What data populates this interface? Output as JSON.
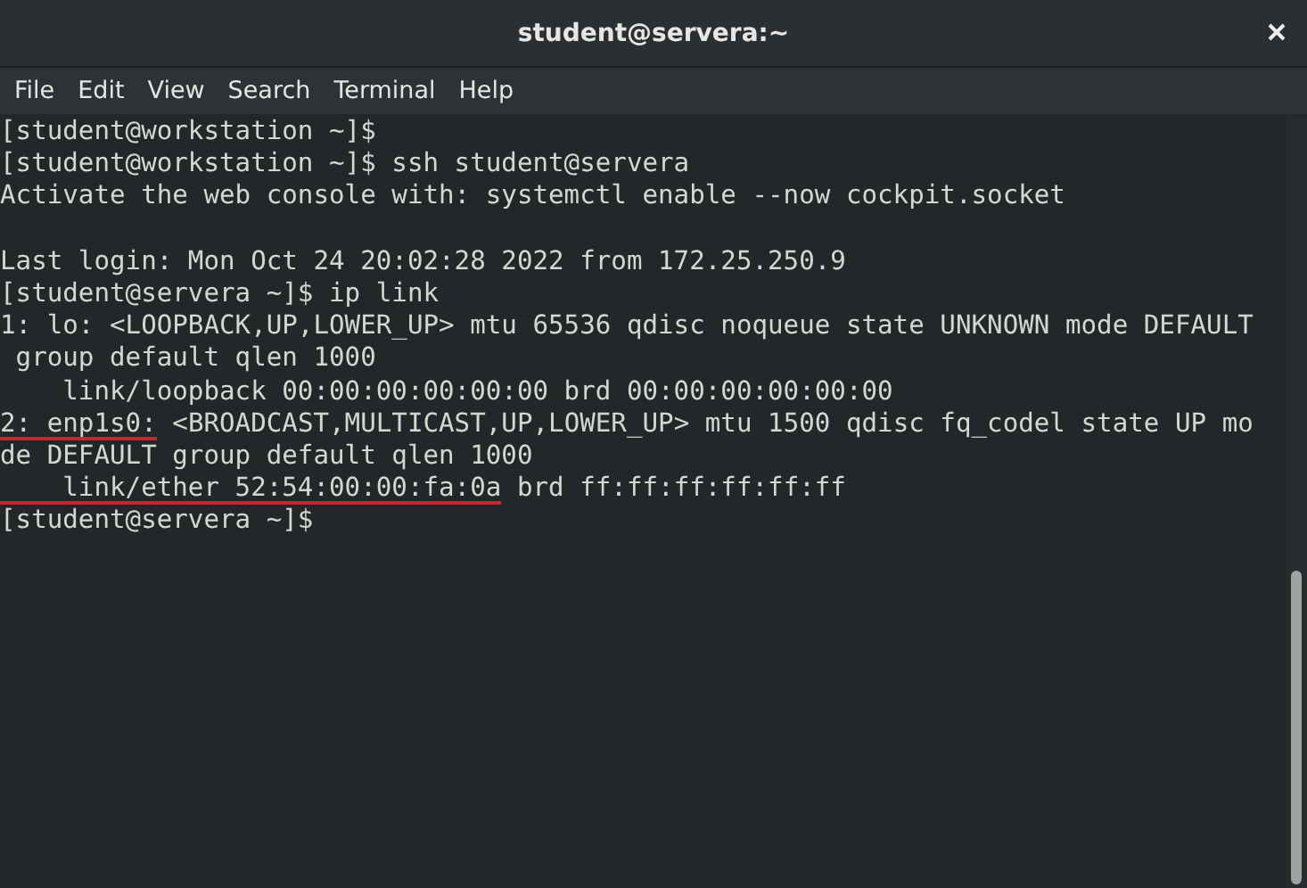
{
  "window": {
    "title": "student@servera:~"
  },
  "menu": [
    "File",
    "Edit",
    "View",
    "Search",
    "Terminal",
    "Help"
  ],
  "terminal": {
    "lines": [
      {
        "kind": "text",
        "segments": [
          {
            "text": "[student@workstation ~]$",
            "underlined": false
          }
        ]
      },
      {
        "kind": "text",
        "segments": [
          {
            "text": "[student@workstation ~]$ ssh student@servera",
            "underlined": false
          }
        ]
      },
      {
        "kind": "text",
        "segments": [
          {
            "text": "Activate the web console with: systemctl enable --now cockpit.socket",
            "underlined": false
          }
        ]
      },
      {
        "kind": "blank"
      },
      {
        "kind": "text",
        "segments": [
          {
            "text": "Last login: Mon Oct 24 20:02:28 2022 from 172.25.250.9",
            "underlined": false
          }
        ]
      },
      {
        "kind": "text",
        "segments": [
          {
            "text": "[student@servera ~]$ ip link",
            "underlined": false
          }
        ]
      },
      {
        "kind": "text",
        "segments": [
          {
            "text": "1: lo: <LOOPBACK,UP,LOWER_UP> mtu 65536 qdisc noqueue state UNKNOWN mode DEFAULT",
            "underlined": false
          }
        ]
      },
      {
        "kind": "text",
        "segments": [
          {
            "text": " group default qlen 1000",
            "underlined": false
          }
        ]
      },
      {
        "kind": "text",
        "segments": [
          {
            "text": "    link/loopback 00:00:00:00:00:00 brd 00:00:00:00:00:00",
            "underlined": false
          }
        ]
      },
      {
        "kind": "text",
        "segments": [
          {
            "text": "2: enp1s0:",
            "underlined": true
          },
          {
            "text": " <BROADCAST,MULTICAST,UP,LOWER_UP> mtu 1500 qdisc fq_codel state UP mo",
            "underlined": false
          }
        ]
      },
      {
        "kind": "text",
        "segments": [
          {
            "text": "de DEFAULT group default qlen 1000",
            "underlined": false
          }
        ]
      },
      {
        "kind": "text",
        "segments": [
          {
            "text": "    link/ether 52:54:00:00:fa:0a",
            "underlined": true
          },
          {
            "text": " brd ff:ff:ff:ff:ff:ff",
            "underlined": false
          }
        ]
      },
      {
        "kind": "text",
        "segments": [
          {
            "text": "[student@servera ~]$",
            "underlined": false
          }
        ]
      }
    ]
  }
}
